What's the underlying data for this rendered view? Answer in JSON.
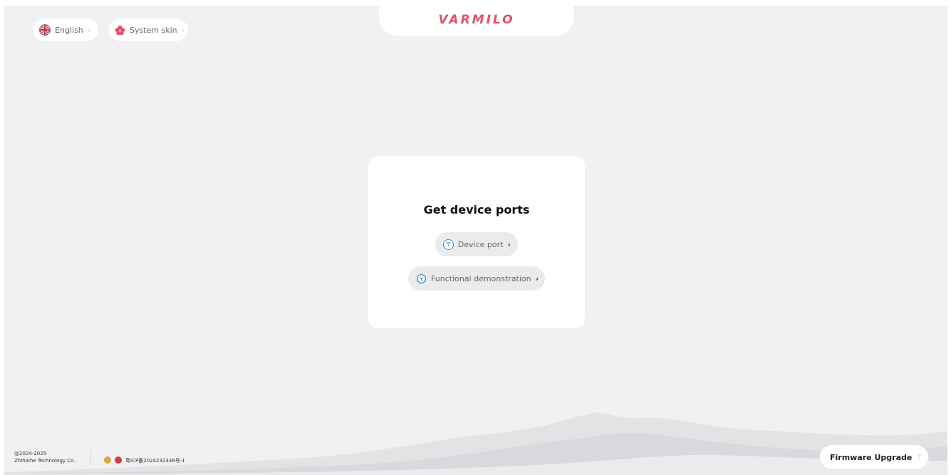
{
  "header": {
    "language_label": "English",
    "skin_label": "System skin",
    "brand": "VARMILO"
  },
  "card": {
    "title": "Get device ports",
    "device_port_label": "Device port",
    "demo_label": "Functional demonstration"
  },
  "footer": {
    "copyright_line1": "@2024-2025",
    "copyright_line2": "Zhihaihe Technology Co.",
    "icp": "粤ICP备2024232336号-1",
    "firmware_label": "Firmware Upgrade"
  },
  "colors": {
    "brand": "#e0506a",
    "accent": "#3a8ee0",
    "background": "#f1f1f3"
  },
  "icons": {
    "language": "uk-flag-icon",
    "skin": "flower-icon",
    "device_port": "wireless-icon",
    "demo": "hexagon-icon",
    "firmware": "upload-icon"
  }
}
